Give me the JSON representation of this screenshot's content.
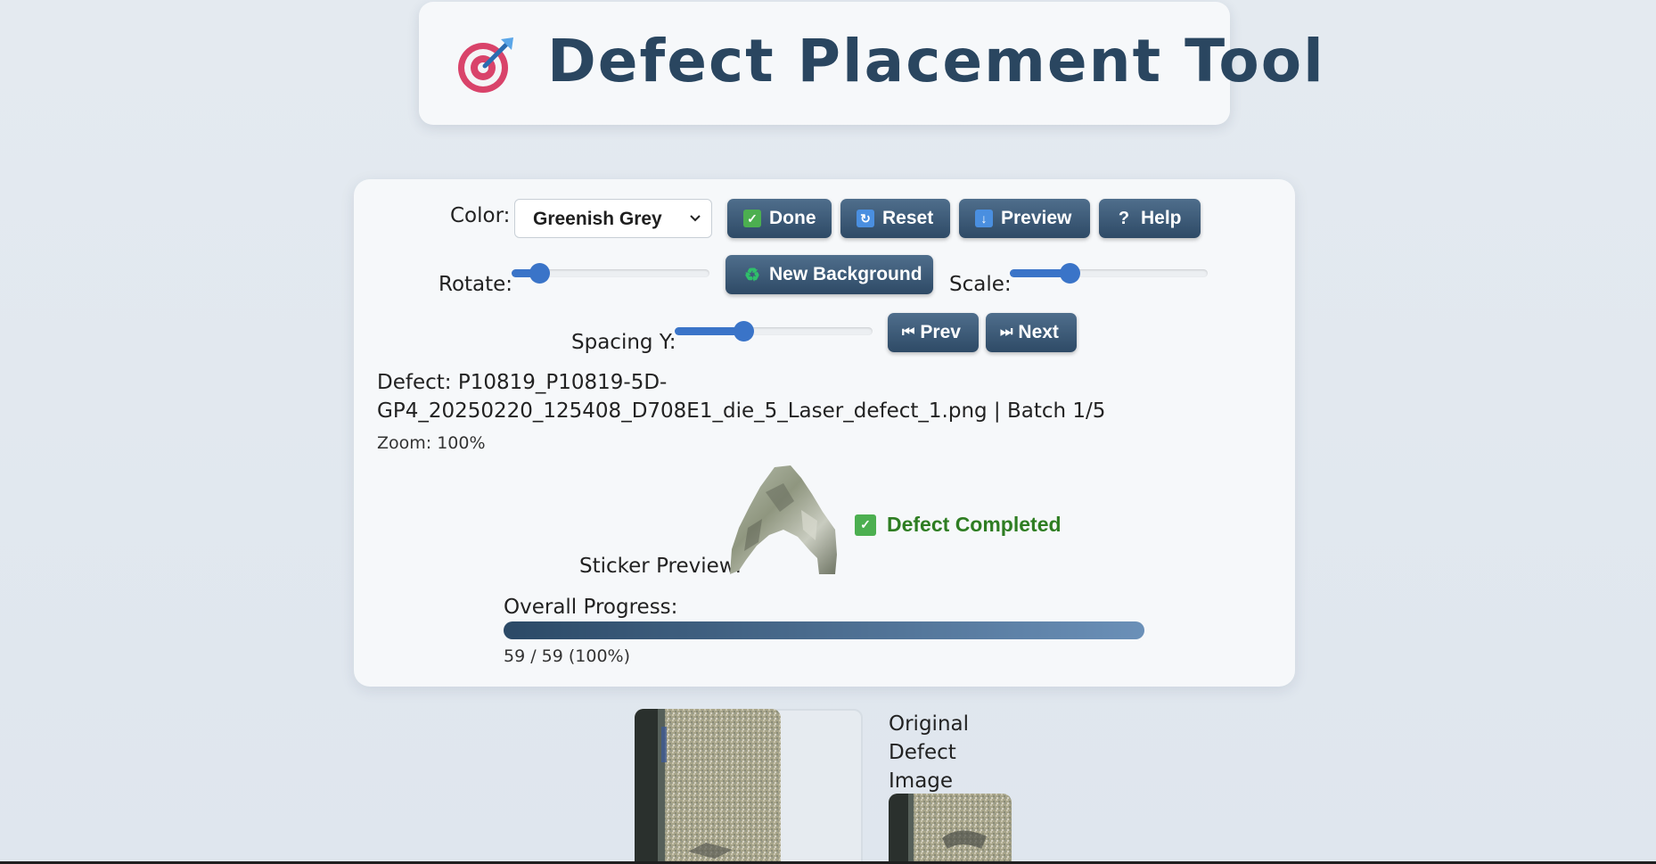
{
  "title": {
    "text": "Defect Placement Tool",
    "icon": "target-dart-icon"
  },
  "controls": {
    "color_label": "Color:",
    "color_value": "Greenish Grey",
    "done_label": "Done",
    "reset_label": "Reset",
    "preview_label": "Preview",
    "help_label": "Help",
    "rotate_label": "Rotate:",
    "rotate_value": 0.1,
    "new_background_label": "New Background",
    "scale_label": "Scale:",
    "scale_value": 0.28,
    "spacing_y_label": "Spacing Y:",
    "spacing_y_value": 0.33,
    "prev_label": "Prev",
    "next_label": "Next"
  },
  "info": {
    "defect_line": "Defect: P10819_P10819-5D-GP4_20250220_125408_D708E1_die_5_Laser_defect_1.png | Batch 1/5",
    "zoom": "Zoom: 100%"
  },
  "sticker": {
    "label": "Sticker Preview:",
    "status": "Defect Completed"
  },
  "progress": {
    "label": "Overall Progress:",
    "text": "59 / 59 (100%)",
    "fraction": 1.0
  },
  "original": {
    "label": "Original Defect Image"
  },
  "colors": {
    "accent": "#3a74c8",
    "button": "#3b5a78",
    "success": "#2e7d22",
    "title": "#2a4660"
  }
}
